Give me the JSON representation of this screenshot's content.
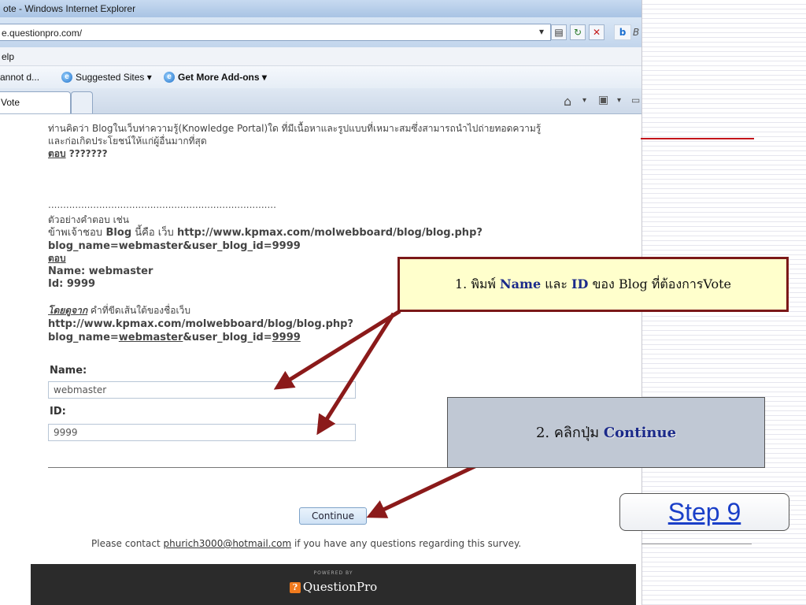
{
  "browser": {
    "window_title": "ote - Windows Internet Explorer",
    "url": "e.questionpro.com/",
    "menu_label": "elp",
    "favorites": [
      {
        "label": "annot d..."
      },
      {
        "label": "Suggested Sites ▾"
      },
      {
        "label": "Get More Add-ons ▾"
      }
    ],
    "tab_label": "Vote",
    "search_hint": "B"
  },
  "survey": {
    "question_line1": "ท่านคิดว่า Blogในเว็บท่าความรู้(Knowledge Portal)ใด ที่มีเนื้อหาและรูปแบบที่เหมาะสมซึ่งสามารถนำไปถ่ายทอดความรู้",
    "question_line2": "และก่อเกิดประโยชน์ให้แก่ผู้อื่นมากที่สุด",
    "answer_label": "ตอบ",
    "answer_value": " ???????",
    "dots": "............................................................................",
    "example_heading": "ตัวอย่างคำตอบ เช่น",
    "example_line1_prefix": "ข้าพเจ้าชอบ",
    "example_line1_bold": " Blog",
    "example_line1_mid": " นี้คือ เว็บ ",
    "example_line1_url": "http://www.kpmax.com/molwebboard/blog/blog.php?",
    "example_line2": "blog_name=webmaster&user_blog_id=9999",
    "answer_label2": "ตอบ",
    "example_name": "Name: webmaster",
    "example_id": "Id: 9999",
    "note_prefix": "โดยดูจาก",
    "note_text": " คำที่ขีดเส้นใต้ของชื่อเว็บ",
    "note_url1": "http://www.kpmax.com/molwebboard/blog/blog.php?",
    "note_url2_a": "blog_name=",
    "note_url2_b": "webmaster",
    "note_url2_c": "&user_blog_id=",
    "note_url2_d": "9999",
    "name_label": "Name:",
    "name_value": "webmaster",
    "id_label": "ID:",
    "id_value": "9999",
    "continue_label": "Continue",
    "contact_prefix": "Please contact ",
    "contact_email": "phurich3000@hotmail.com",
    "contact_suffix": " if you have any questions regarding this survey.",
    "powered_by": "POWERED BY",
    "brand": "QuestionPro"
  },
  "annotations": {
    "callout1_prefix": "1. พิมพ์ ",
    "callout1_name": "Name",
    "callout1_mid": " และ ",
    "callout1_id": "ID",
    "callout1_suffix": " ของ Blog ที่ต้องการVote",
    "callout2_prefix": "2. คลิกปุ่ม ",
    "callout2_button": "Continue",
    "step_label": "Step 9",
    "arrow_color": "#8b1a1a"
  }
}
